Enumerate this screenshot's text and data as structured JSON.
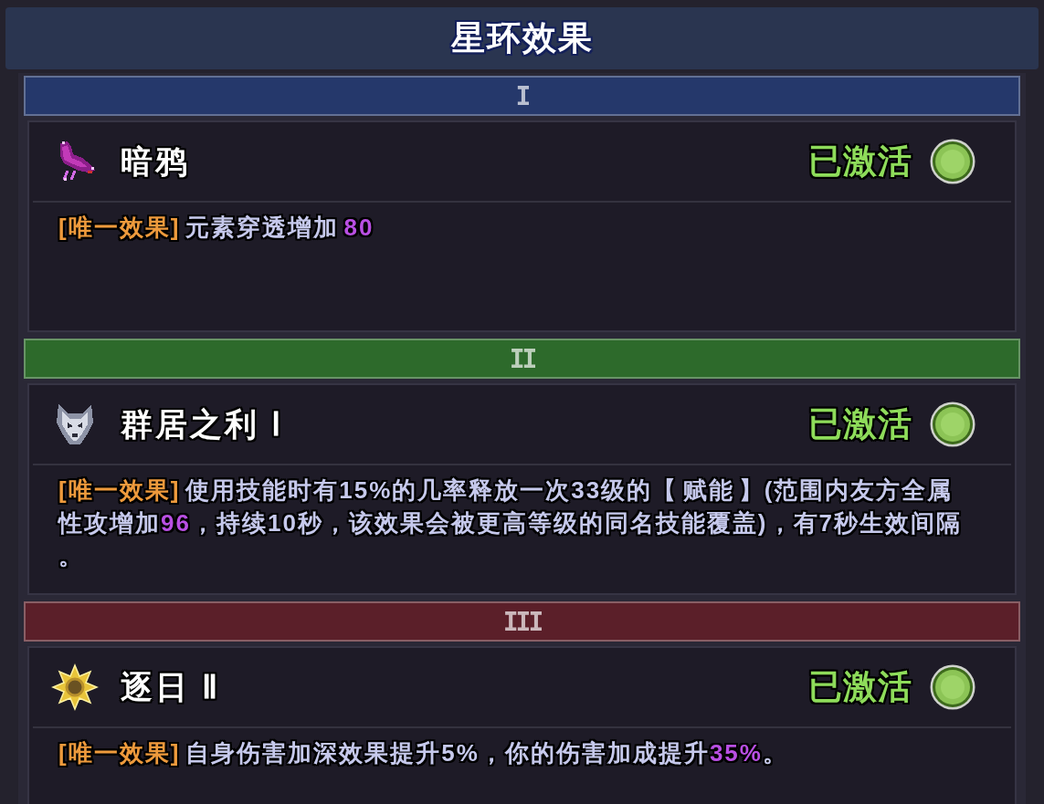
{
  "title": "星环效果",
  "tiers": [
    {
      "numeral": "I",
      "color": "#25386b",
      "effect": {
        "name": "暗鸦",
        "status": "已激活",
        "active": true,
        "description": {
          "tag": "[唯一效果]",
          "parts": [
            {
              "kind": "plain",
              "text": "元素穿透增加 "
            },
            {
              "kind": "value",
              "text": "80"
            }
          ]
        }
      }
    },
    {
      "numeral": "II",
      "color": "#2d6a2b",
      "effect": {
        "name": "群居之利 Ⅰ",
        "status": "已激活",
        "active": true,
        "description": {
          "tag": "[唯一效果]",
          "parts": [
            {
              "kind": "plain",
              "text": "使用技能时有15%的几率释放一次33级的【 赋能 】(范围内友方全属性攻增加"
            },
            {
              "kind": "value",
              "text": "96"
            },
            {
              "kind": "plain",
              "text": "，持续10秒，该效果会被更高等级的同名技能覆盖)，有7秒生效间隔。"
            }
          ]
        }
      }
    },
    {
      "numeral": "III",
      "color": "#5b1f29",
      "effect": {
        "name": "逐日 Ⅱ",
        "status": "已激活",
        "active": true,
        "description": {
          "tag": "[唯一效果]",
          "parts": [
            {
              "kind": "plain",
              "text": "自身伤害加深效果提升5%，你的伤害加成提升"
            },
            {
              "kind": "value",
              "text": "35%"
            },
            {
              "kind": "plain",
              "text": "。"
            }
          ]
        }
      }
    }
  ]
}
